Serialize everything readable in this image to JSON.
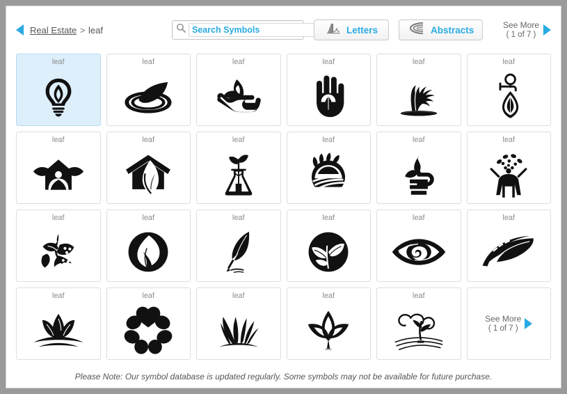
{
  "header": {
    "back_arrow_icon": "back-triangle-icon",
    "breadcrumb": {
      "parent": "Real Estate",
      "separator": ">",
      "current": "leaf"
    },
    "search": {
      "icon": "search-icon",
      "placeholder": "Search Symbols",
      "value": ""
    },
    "buttons": [
      {
        "label": "Letters",
        "icon": "letters-glyph-icon"
      },
      {
        "label": "Abstracts",
        "icon": "abstracts-arcs-icon"
      }
    ],
    "see_more": {
      "label": "See More",
      "count": "( 1 of 7 )",
      "icon": "forward-triangle-icon"
    }
  },
  "grid": {
    "see_more": {
      "label": "See More",
      "count": "( 1 of 7 )",
      "icon": "forward-triangle-icon"
    },
    "cells": [
      {
        "label": "leaf",
        "icon": "lightbulb-leaf-icon",
        "selected": true
      },
      {
        "label": "leaf",
        "icon": "leaf-ripple-water-icon",
        "selected": false
      },
      {
        "label": "leaf",
        "icon": "hand-holding-leaf-icon",
        "selected": false
      },
      {
        "label": "leaf",
        "icon": "open-palm-leaf-icon",
        "selected": false
      },
      {
        "label": "leaf",
        "icon": "olive-tree-icon",
        "selected": false
      },
      {
        "label": "leaf",
        "icon": "faucet-leaf-drop-icon",
        "selected": false
      },
      {
        "label": "leaf",
        "icon": "house-leaves-person-icon",
        "selected": false
      },
      {
        "label": "leaf",
        "icon": "house-leaf-roof-icon",
        "selected": false
      },
      {
        "label": "leaf",
        "icon": "sprout-flask-icon",
        "selected": false
      },
      {
        "label": "leaf",
        "icon": "circle-field-leaves-icon",
        "selected": false
      },
      {
        "label": "leaf",
        "icon": "leaf-books-stack-icon",
        "selected": false
      },
      {
        "label": "leaf",
        "icon": "person-tree-dots-icon",
        "selected": false
      },
      {
        "label": "leaf",
        "icon": "butterfly-leaf-brush-icon",
        "selected": false
      },
      {
        "label": "leaf",
        "icon": "circle-leaf-negative-icon",
        "selected": false
      },
      {
        "label": "leaf",
        "icon": "feather-quill-icon",
        "selected": false
      },
      {
        "label": "leaf",
        "icon": "circle-two-leaves-icon",
        "selected": false
      },
      {
        "label": "leaf",
        "icon": "eye-leaf-icon",
        "selected": false
      },
      {
        "label": "leaf",
        "icon": "leaf-swoosh-road-icon",
        "selected": false
      },
      {
        "label": "leaf",
        "icon": "lotus-sunrise-icon",
        "selected": false
      },
      {
        "label": "leaf",
        "icon": "flower-petals-heart-icon",
        "selected": false
      },
      {
        "label": "leaf",
        "icon": "grass-tuft-icon",
        "selected": false
      },
      {
        "label": "leaf",
        "icon": "three-petal-outline-icon",
        "selected": false
      },
      {
        "label": "leaf",
        "icon": "sprout-water-lines-icon",
        "selected": false
      }
    ]
  },
  "footer": {
    "note": "Please Note: Our symbol database is updated regularly. Some symbols may not be available for future purchase."
  },
  "colors": {
    "accent": "#29ABE2",
    "frame": "#9a9a9a",
    "selected_cell": "#ddeffb",
    "label_gray": "#8c8c8c",
    "symbol_black": "#111111"
  }
}
